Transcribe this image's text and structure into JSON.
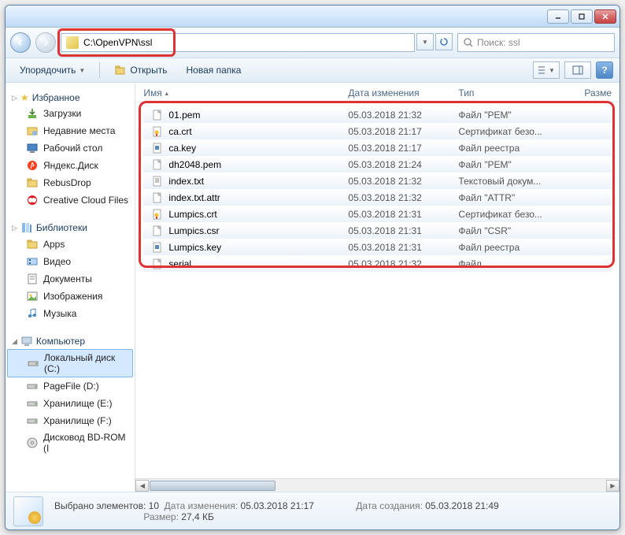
{
  "address": {
    "path": "C:\\OpenVPN\\ssl"
  },
  "search": {
    "placeholder": "Поиск: ssl"
  },
  "toolbar": {
    "organize": "Упорядочить",
    "open": "Открыть",
    "new_folder": "Новая папка"
  },
  "columns": {
    "name": "Имя",
    "date": "Дата изменения",
    "type": "Тип",
    "size": "Разме"
  },
  "sidebar": {
    "favorites": {
      "label": "Избранное",
      "items": [
        {
          "label": "Загрузки",
          "icon": "download"
        },
        {
          "label": "Недавние места",
          "icon": "recent"
        },
        {
          "label": "Рабочий стол",
          "icon": "desktop"
        },
        {
          "label": "Яндекс.Диск",
          "icon": "yadisk"
        },
        {
          "label": "RebusDrop",
          "icon": "folder"
        },
        {
          "label": "Creative Cloud Files",
          "icon": "cc"
        }
      ]
    },
    "libraries": {
      "label": "Библиотеки",
      "items": [
        {
          "label": "Apps",
          "icon": "folder"
        },
        {
          "label": "Видео",
          "icon": "video"
        },
        {
          "label": "Документы",
          "icon": "doc"
        },
        {
          "label": "Изображения",
          "icon": "image"
        },
        {
          "label": "Музыка",
          "icon": "music"
        }
      ]
    },
    "computer": {
      "label": "Компьютер",
      "items": [
        {
          "label": "Локальный диск (C:)",
          "icon": "drive",
          "selected": true
        },
        {
          "label": "PageFile (D:)",
          "icon": "drive"
        },
        {
          "label": "Хранилище (E:)",
          "icon": "drive"
        },
        {
          "label": "Хранилище (F:)",
          "icon": "drive"
        },
        {
          "label": "Дисковод BD-ROM (I",
          "icon": "bdrom"
        }
      ]
    }
  },
  "files": [
    {
      "name": "01.pem",
      "date": "05.03.2018 21:32",
      "type": "Файл \"PEM\"",
      "icon": "file"
    },
    {
      "name": "ca.crt",
      "date": "05.03.2018 21:17",
      "type": "Сертификат безо...",
      "icon": "cert"
    },
    {
      "name": "ca.key",
      "date": "05.03.2018 21:17",
      "type": "Файл реестра",
      "icon": "reg"
    },
    {
      "name": "dh2048.pem",
      "date": "05.03.2018 21:24",
      "type": "Файл \"PEM\"",
      "icon": "file"
    },
    {
      "name": "index.txt",
      "date": "05.03.2018 21:32",
      "type": "Текстовый докум...",
      "icon": "txt"
    },
    {
      "name": "index.txt.attr",
      "date": "05.03.2018 21:32",
      "type": "Файл \"ATTR\"",
      "icon": "file"
    },
    {
      "name": "Lumpics.crt",
      "date": "05.03.2018 21:31",
      "type": "Сертификат безо...",
      "icon": "cert"
    },
    {
      "name": "Lumpics.csr",
      "date": "05.03.2018 21:31",
      "type": "Файл \"CSR\"",
      "icon": "file"
    },
    {
      "name": "Lumpics.key",
      "date": "05.03.2018 21:31",
      "type": "Файл реестра",
      "icon": "reg"
    },
    {
      "name": "serial",
      "date": "05.03.2018 21:32",
      "type": "Файл",
      "icon": "file"
    }
  ],
  "status": {
    "selected": "Выбрано элементов: 10",
    "date_mod_lbl": "Дата изменения:",
    "date_mod_val": "05.03.2018 21:17",
    "size_lbl": "Размер:",
    "size_val": "27,4 КБ",
    "date_created_lbl": "Дата создания:",
    "date_created_val": "05.03.2018 21:49"
  },
  "help": "?"
}
